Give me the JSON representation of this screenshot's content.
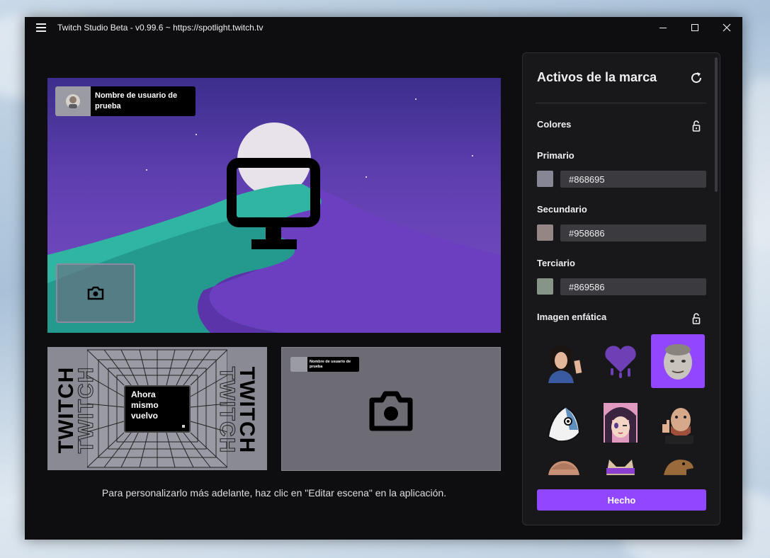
{
  "window": {
    "title": "Twitch Studio Beta - v0.99.6 ~ https://spotlight.twitch.tv"
  },
  "preview": {
    "username_tag": "Nombre de usuario de prueba",
    "brb_lines": [
      "Ahora",
      "mismo",
      "vuelvo"
    ],
    "brb_side_text": "TWITCH",
    "mini_username_tag": "Nombre de usuario de prueba",
    "hint": "Para personalizarlo más adelante, haz clic en \"Editar escena\" en la aplicación."
  },
  "panel": {
    "title": "Activos de la marca",
    "colors_label": "Colores",
    "primary_label": "Primario",
    "primary_value": "#868695",
    "secondary_label": "Secundario",
    "secondary_value": "#958686",
    "tertiary_label": "Terciario",
    "tertiary_value": "#869586",
    "image_label": "Imagen enfática",
    "done_label": "Hecho",
    "emotes": [
      {
        "name": "woman-waving",
        "selected": false
      },
      {
        "name": "purple-heart-drip",
        "selected": false
      },
      {
        "name": "kappa-face",
        "selected": true
      },
      {
        "name": "fish-face",
        "selected": false
      },
      {
        "name": "anime-girl-wink",
        "selected": false
      },
      {
        "name": "man-thumbs-up",
        "selected": false
      },
      {
        "name": "bald-head",
        "selected": false
      },
      {
        "name": "cat-sunglasses",
        "selected": false
      },
      {
        "name": "dinosaur",
        "selected": false
      }
    ]
  },
  "colors": {
    "accent": "#9147ff",
    "background": "#0e0e10",
    "panel": "#18181b"
  }
}
